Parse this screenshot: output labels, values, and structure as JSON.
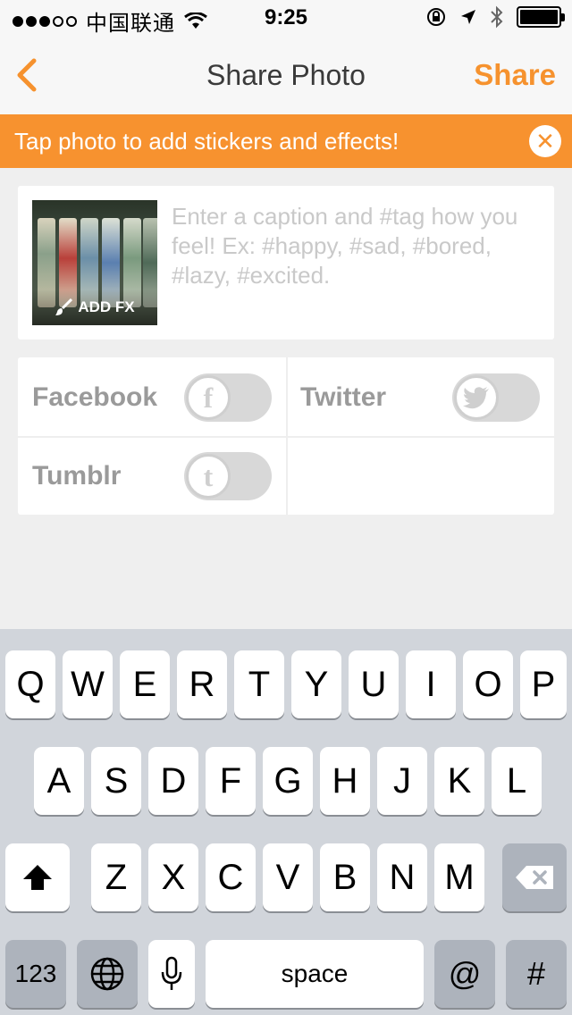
{
  "status_bar": {
    "carrier": "中国联通",
    "time": "9:25"
  },
  "nav": {
    "title": "Share Photo",
    "share_label": "Share",
    "back_icon": "chevron-left-icon"
  },
  "banner": {
    "text": "Tap photo to add stickers and effects!",
    "close_glyph": "✕"
  },
  "caption": {
    "placeholder": "Enter a caption and #tag how you feel! Ex: #happy, #sad, #bored, #lazy, #excited.",
    "add_fx_label": "ADD FX"
  },
  "share_targets": [
    {
      "label": "Facebook",
      "glyph": "f",
      "enabled": false
    },
    {
      "label": "Twitter",
      "glyph": "bird",
      "enabled": false
    },
    {
      "label": "Tumblr",
      "glyph": "t",
      "enabled": false
    }
  ],
  "keyboard": {
    "row1": [
      "Q",
      "W",
      "E",
      "R",
      "T",
      "Y",
      "U",
      "I",
      "O",
      "P"
    ],
    "row2": [
      "A",
      "S",
      "D",
      "F",
      "G",
      "H",
      "J",
      "K",
      "L"
    ],
    "row3": [
      "Z",
      "X",
      "C",
      "V",
      "B",
      "N",
      "M"
    ],
    "numbers_label": "123",
    "space_label": "space",
    "at_label": "@",
    "hash_label": "#"
  },
  "colors": {
    "accent": "#f7922f",
    "keyboard_bg": "#d1d5db"
  }
}
